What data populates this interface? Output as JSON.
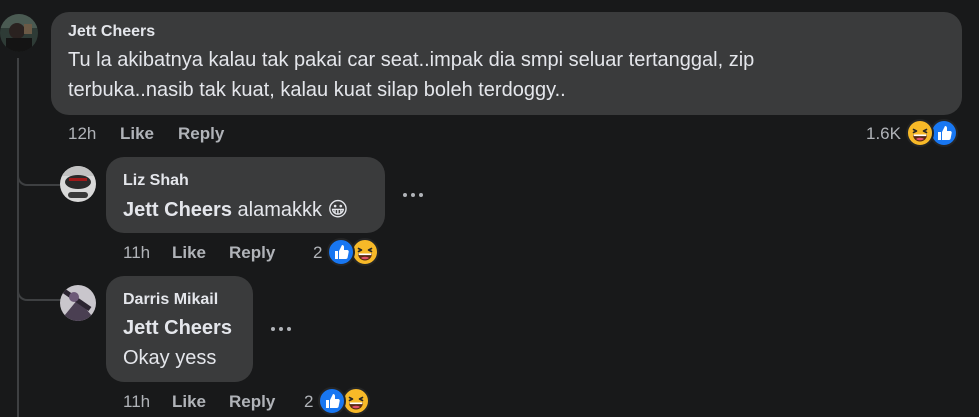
{
  "comments": [
    {
      "author": "Jett Cheers",
      "lines": [
        "Tu la akibatnya kalau tak pakai car seat..impak dia smpi seluar tertanggal, zip",
        "terbuka..nasib tak kuat, kalau kuat silap boleh terdoggy.."
      ],
      "time": "12h",
      "like_label": "Like",
      "reply_label": "Reply",
      "reaction_count": "1.6K",
      "reactions": [
        "laugh-icon",
        "like-icon"
      ]
    }
  ],
  "replies": [
    {
      "author": "Liz Shah",
      "mention": "Jett Cheers",
      "text": "alamakkk",
      "emoji": "😀",
      "time": "11h",
      "like_label": "Like",
      "reply_label": "Reply",
      "reaction_count": "2",
      "reactions": [
        "like-icon",
        "laugh-icon"
      ]
    },
    {
      "author": "Darris Mikail",
      "mention": "Jett Cheers",
      "text": "Okay yess",
      "time": "11h",
      "like_label": "Like",
      "reply_label": "Reply",
      "reaction_count": "2",
      "reactions": [
        "like-icon",
        "laugh-icon"
      ]
    }
  ],
  "colors": {
    "background": "#18191a",
    "bubble": "#3a3b3c",
    "text": "#e4e6eb",
    "secondary_text": "#b0b3b8",
    "like_blue": "#1877f2",
    "haha_yellow": "#f7b928"
  }
}
